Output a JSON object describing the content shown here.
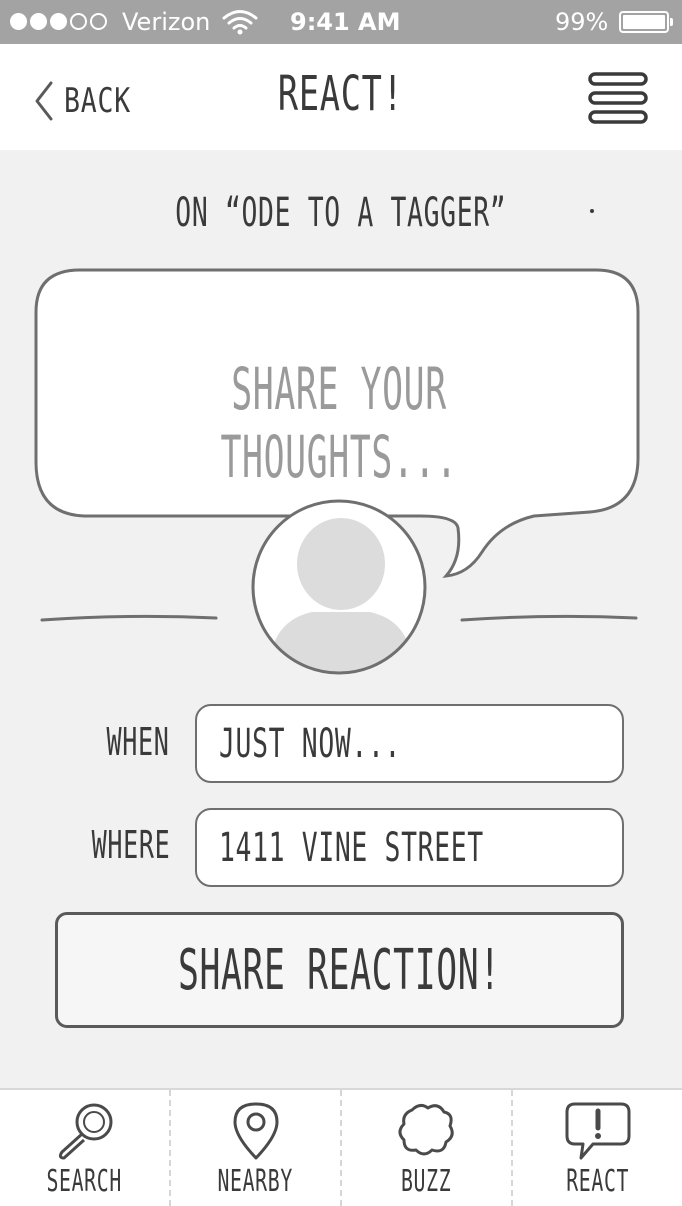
{
  "status_bar": {
    "signal_dots_filled": 3,
    "signal_dots_total": 5,
    "carrier": "Verizon",
    "wifi_icon": "wifi-icon",
    "time": "9:41 AM",
    "battery_percent": "99%",
    "battery_level": 0.99
  },
  "nav": {
    "back_label": "BACK",
    "back_icon": "chevron-left-icon",
    "title": "REACT!",
    "menu_icon": "hamburger-menu-icon"
  },
  "content": {
    "subtitle": "ON “ODE TO A TAGGER”",
    "thoughts_placeholder": "SHARE YOUR THOUGHTS...",
    "avatar_icon": "user-avatar-icon",
    "when_label": "WHEN",
    "when_value": "JUST NOW...",
    "where_label": "WHERE",
    "where_value": "1411 VINE STREET",
    "share_button_label": "SHARE REACTION!"
  },
  "tabs": [
    {
      "label": "SEARCH",
      "icon": "magnifier-icon"
    },
    {
      "label": "NEARBY",
      "icon": "map-pin-icon"
    },
    {
      "label": "BUZZ",
      "icon": "buzz-cloud-icon"
    },
    {
      "label": "REACT",
      "icon": "exclamation-bubble-icon"
    }
  ],
  "colors": {
    "status_bar": "#a3a3a3",
    "content_background": "#f1f1f1",
    "stroke": "#6f6f6f",
    "placeholder_text": "#9a9a9a"
  }
}
